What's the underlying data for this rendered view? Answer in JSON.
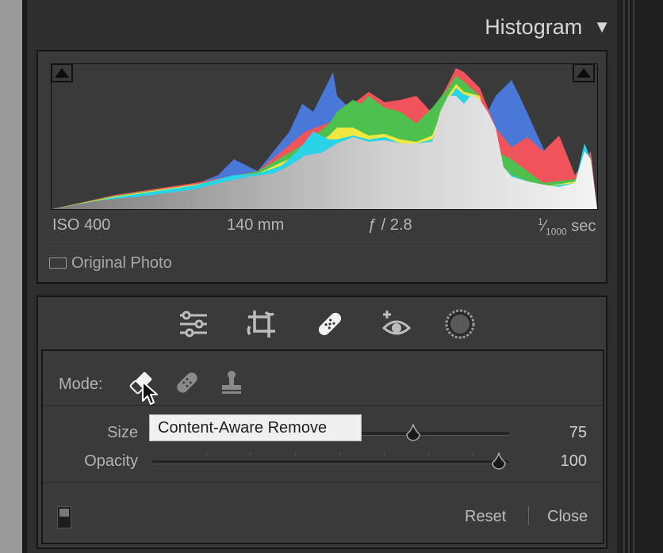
{
  "histogram": {
    "title": "Histogram",
    "collapse_icon": "triangle-down-icon",
    "exif": {
      "iso": "ISO 400",
      "focal_length": "140 mm",
      "aperture": "ƒ / 2.8",
      "shutter_num": "1",
      "shutter_den": "1000",
      "shutter_unit": "sec"
    },
    "original_photo_label": "Original Photo"
  },
  "tool_strip": {
    "icons": [
      "sliders-icon",
      "crop-rotate-icon",
      "bandage-icon",
      "red-eye-icon",
      "masking-icon"
    ]
  },
  "remove_panel": {
    "mode_label": "Mode:",
    "mode_icons": [
      "eraser-icon",
      "bandage-icon",
      "stamp-icon"
    ],
    "tooltip": "Content-Aware Remove",
    "size": {
      "label": "Size",
      "value": "75",
      "level": 0.75
    },
    "opacity": {
      "label": "Opacity",
      "value": "100",
      "level": 1.0
    },
    "reset_label": "Reset",
    "close_label": "Close"
  },
  "colors": {
    "blue": "#4a78d8",
    "cyan": "#2ad4e8",
    "green": "#4ec04e",
    "yellow": "#f0e840",
    "red": "#f0545a",
    "gray": "#d8d8d8"
  }
}
